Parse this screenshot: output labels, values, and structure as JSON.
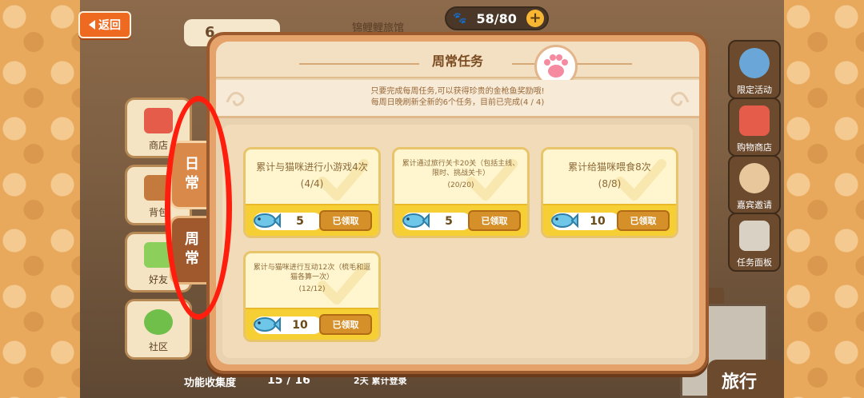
{
  "header": {
    "back_label": "返回",
    "top_left_value": "6",
    "top_center_label": "锦鲤鲤旅馆",
    "counter": "58/80"
  },
  "left_menu": [
    {
      "label": "商店"
    },
    {
      "label": "背包"
    },
    {
      "label": "好友"
    },
    {
      "label": "社区"
    }
  ],
  "right_menu": [
    {
      "label": "限定活动"
    },
    {
      "label": "购物商店"
    },
    {
      "label": "嘉宾邀请"
    },
    {
      "label": "任务面板"
    }
  ],
  "travel_label": "旅行",
  "bottom": {
    "collection_label": "功能收集度",
    "collection_value": "15 / 16",
    "login_label": "2天 累计登录"
  },
  "side_tabs": {
    "daily": "日常",
    "weekly": "周常"
  },
  "dialog": {
    "title": "周常任务",
    "info_line1": "只要完成每周任务,可以获得珍贵的金枪鱼奖励哦!",
    "info_line2": "每周日晚刷新全新的6个任务，目前已完成(4 / 4)"
  },
  "tasks": [
    {
      "title": "累计与猫咪进行小游戏4次",
      "progress": "(4/4)",
      "reward": "5",
      "button": "已领取"
    },
    {
      "title": "累计通过旅行关卡20关（包括主线、限时、挑战关卡）",
      "progress": "(20/20)",
      "reward": "5",
      "button": "已领取"
    },
    {
      "title": "累计给猫咪喂食8次",
      "progress": "(8/8)",
      "reward": "10",
      "button": "已领取"
    },
    {
      "title": "累计与猫咪进行互动12次（梳毛和逗猫各算一次）",
      "progress": "(12/12)",
      "reward": "10",
      "button": "已领取"
    }
  ],
  "colors": {
    "accent_orange": "#ee6a20",
    "highlight_red": "#ff1e0e",
    "reward_yellow": "#f6cf35",
    "claimed_button": "#d6902a"
  },
  "icons": [
    "back-arrow-icon",
    "paw-icon",
    "plus-icon",
    "fish-icon",
    "check-watermark-icon",
    "shop-icon",
    "bag-icon",
    "friend-icon",
    "community-icon"
  ]
}
